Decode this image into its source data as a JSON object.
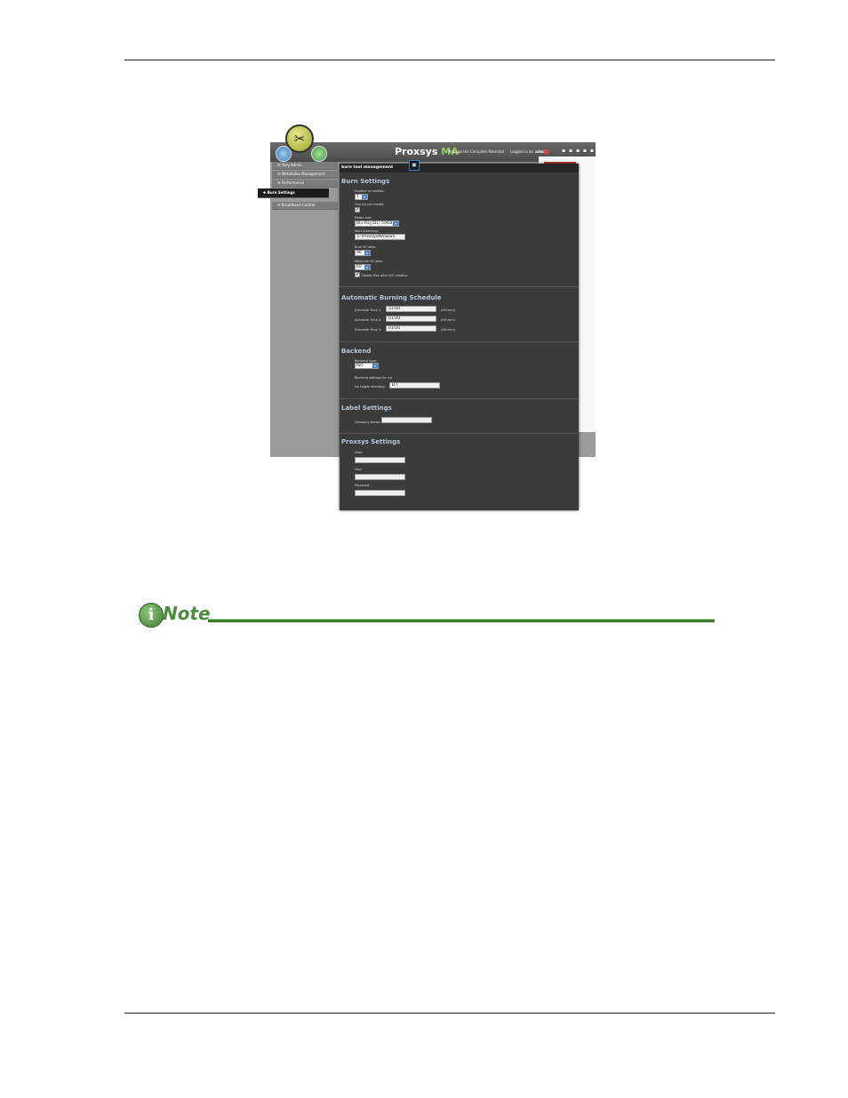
{
  "app": {
    "logo_main": "Proxsys",
    "logo_suffix": "MA",
    "tagline": "Manage the Complete Potential",
    "login_prefix": "Logged in as:",
    "login_user": "admin",
    "top_icons": "▪ ▪ ▪ ▪ ▪"
  },
  "sidebar": {
    "items": [
      {
        "label": "☰  Vary Admin"
      },
      {
        "label": "☰  MetaIndex Management"
      },
      {
        "label": "☰  Performance"
      },
      {
        "label": "✚  Burn Settings"
      },
      {
        "label": "☰  Broadband Control"
      }
    ]
  },
  "panel": {
    "title": "burn tool management",
    "icon": "▣",
    "burn": {
      "heading": "Burn Settings",
      "num_medias_label": "Number of medias:",
      "num_medias_value": "1",
      "one_iso_label": "One iso per media:",
      "one_iso_checked": "✔",
      "media_size_label": "Media size:",
      "media_size_value": "Blu-Ray(DL) 50GB",
      "work_dir_label": "Work Directory:",
      "work_dir_value": "C:\\ProxsysMA\\work",
      "burn_fill_label": "Burn fill ratio:",
      "burn_fill_value": "96",
      "min_fill_label": "Minimum fill ratio:",
      "min_fill_value": "60",
      "delete_checked": "✔",
      "delete_label": "Delete files after ISO creation"
    },
    "schedule": {
      "heading": "Automatic Burning Schedule",
      "rows": [
        {
          "label": "Schedule Time 1:",
          "value": "23:00",
          "unit": "(HH:mm)"
        },
        {
          "label": "Schedule Time 2:",
          "value": "01:00",
          "unit": "(HH:mm)"
        },
        {
          "label": "Schedule Time 3:",
          "value": "03:00",
          "unit": "(HH:mm)"
        }
      ]
    },
    "backend": {
      "heading": "Backend",
      "type_label": "Backend type:",
      "type_value": "ISO",
      "settings_label": "Backend settings for iso",
      "target_label": "Iso target directory:",
      "target_value": "D:\\"
    },
    "label_settings": {
      "heading": "Label Settings",
      "company_label": "Company Name:",
      "company_value": ""
    },
    "proxsys": {
      "heading": "Proxsys Settings",
      "host_label": "Host:",
      "user_label": "User:",
      "password_label": "Password:"
    }
  },
  "note": {
    "icon_letter": "i",
    "word": "Note"
  }
}
